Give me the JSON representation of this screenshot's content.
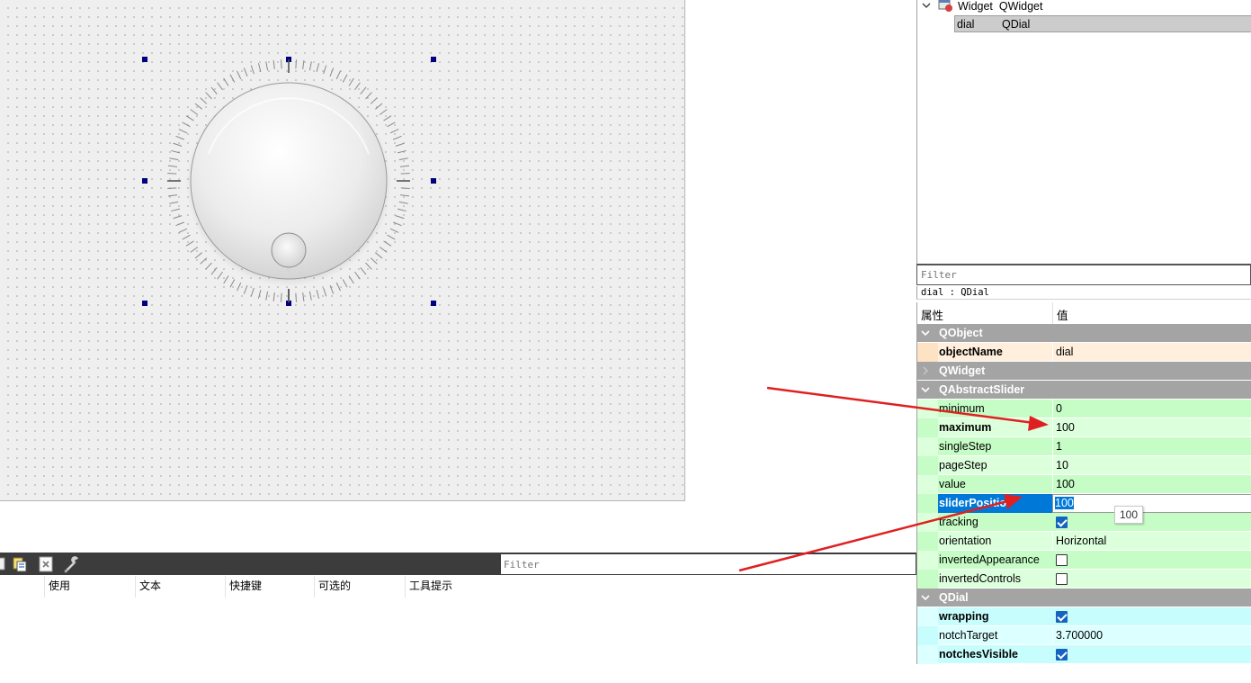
{
  "object_inspector": {
    "root": {
      "name": "Widget",
      "class": "QWidget"
    },
    "child": {
      "name": "dial",
      "class": "QDial"
    }
  },
  "property_editor": {
    "filter_placeholder": "Filter",
    "caption": "dial : QDial",
    "header": {
      "property": "属性",
      "value": "值"
    },
    "groups": {
      "qobject": "QObject",
      "qwidget": "QWidget",
      "qabstractslider": "QAbstractSlider",
      "qdial": "QDial"
    },
    "props": {
      "objectName": {
        "name": "objectName",
        "value": "dial"
      },
      "minimum": {
        "name": "minimum",
        "value": "0"
      },
      "maximum": {
        "name": "maximum",
        "value": "100"
      },
      "singleStep": {
        "name": "singleStep",
        "value": "1"
      },
      "pageStep": {
        "name": "pageStep",
        "value": "10"
      },
      "value": {
        "name": "value",
        "value": "100"
      },
      "sliderPosition": {
        "name": "sliderPositio",
        "value": "100"
      },
      "tracking": {
        "name": "tracking",
        "checked": true
      },
      "orientation": {
        "name": "orientation",
        "value": "Horizontal"
      },
      "invertedAppearance": {
        "name": "invertedAppearance",
        "checked": false
      },
      "invertedControls": {
        "name": "invertedControls",
        "checked": false
      },
      "wrapping": {
        "name": "wrapping",
        "checked": true
      },
      "notchTarget": {
        "name": "notchTarget",
        "value": "3.700000"
      },
      "notchesVisible": {
        "name": "notchesVisible",
        "checked": true
      }
    },
    "tooltip": "100"
  },
  "action_editor": {
    "filter_placeholder": "Filter",
    "columns": [
      "使用",
      "文本",
      "快捷键",
      "可选的",
      "工具提示"
    ]
  },
  "colors": {
    "annotation_arrow": "#e02020",
    "selection_handle": "#000080",
    "selection_blue": "#0078d7",
    "group_header": "#a4a4a4"
  }
}
